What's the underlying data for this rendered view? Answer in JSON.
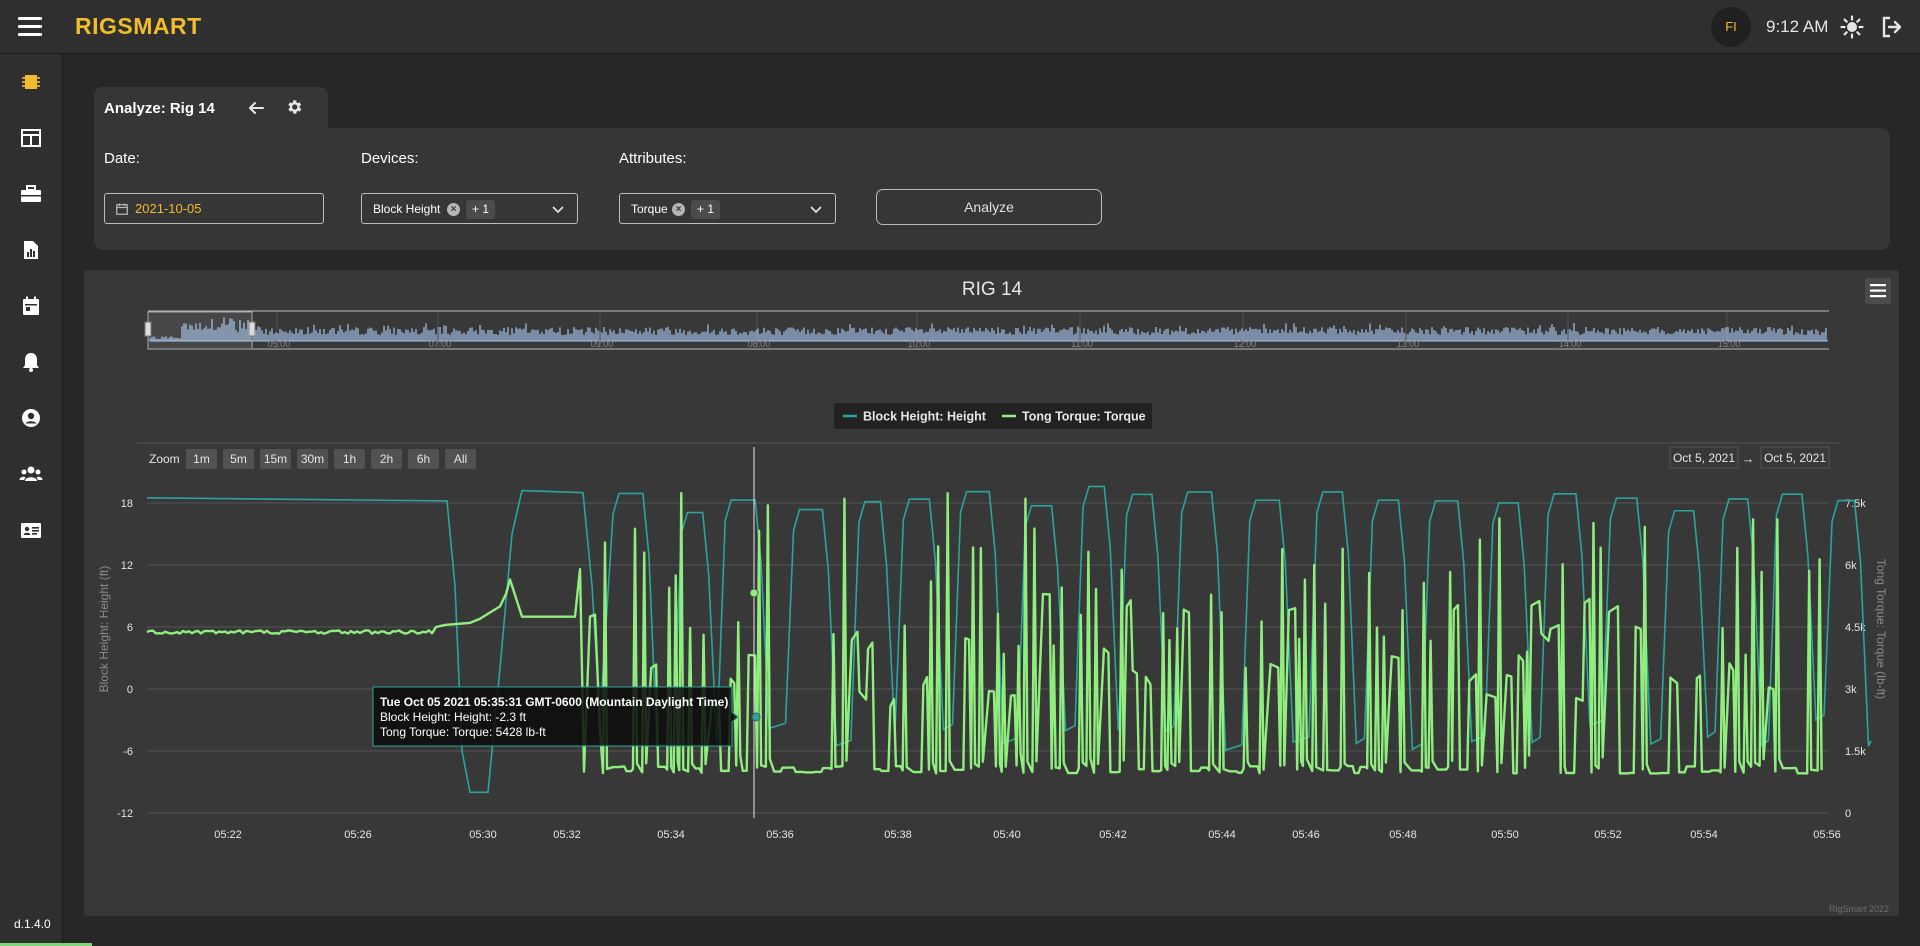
{
  "app": {
    "brand": "RIGSMART",
    "user_initials": "FI",
    "time": "9:12 AM",
    "version": "d.1.4.0",
    "credit": "RigSmart 2022",
    "accent_color": "#f2bd2c"
  },
  "sidebar": {
    "items": [
      {
        "name": "chip-icon"
      },
      {
        "name": "layout-icon"
      },
      {
        "name": "toolbox-icon"
      },
      {
        "name": "report-icon"
      },
      {
        "name": "calendar-icon"
      },
      {
        "name": "bell-icon"
      },
      {
        "name": "user-circle-icon"
      },
      {
        "name": "users-icon"
      },
      {
        "name": "id-card-icon"
      }
    ]
  },
  "analyze_tab": {
    "title": "Analyze: Rig 14"
  },
  "filters": {
    "date_label": "Date:",
    "date_value": "2021-10-05",
    "devices_label": "Devices:",
    "devices_selected": "Block Height",
    "devices_more": "+ 1",
    "attributes_label": "Attributes:",
    "attributes_selected": "Torque",
    "attributes_more": "+ 1",
    "analyze_button": "Analyze"
  },
  "chart_data": {
    "type": "line",
    "title": "RIG 14",
    "zoom_label": "Zoom",
    "zoom_buttons": [
      "1m",
      "5m",
      "15m",
      "30m",
      "1h",
      "2h",
      "6h",
      "All"
    ],
    "range_from": "Oct 5, 2021",
    "range_to": "Oct 5, 2021",
    "range_arrow": "→",
    "navigator_ticks": [
      "05:00",
      "07:00",
      "09:00",
      "08:00",
      "10:00",
      "11:00",
      "12:00",
      "13:00",
      "14:00",
      "15:00"
    ],
    "x_ticks": [
      "05:22",
      "05:26",
      "05:30",
      "05:32",
      "05:34",
      "05:36",
      "05:38",
      "05:40",
      "05:42",
      "05:44",
      "05:46",
      "05:48",
      "05:50",
      "05:52",
      "05:54",
      "05:56"
    ],
    "y_left": {
      "label": "Block Height: Height (ft)",
      "ticks": [
        "18",
        "12",
        "6",
        "0",
        "-6",
        "-12"
      ],
      "range": [
        -12,
        18
      ]
    },
    "y_right": {
      "label": "Tong Torque: Torque (lb-ft)",
      "ticks": [
        "7.5k",
        "6k",
        "4.5k",
        "3k",
        "1.5k",
        "0"
      ],
      "range": [
        0,
        7500
      ]
    },
    "series": [
      {
        "name": "Block Height: Height",
        "color": "#2aa59b",
        "axis": "left"
      },
      {
        "name": "Tong Torque: Torque",
        "color": "#90ee7e",
        "axis": "right"
      }
    ],
    "tooltip": {
      "header": "Tue Oct 05 2021 05:35:31 GMT-0600 (Mountain Daylight Time)",
      "line1": "Block Height: Height: -2.3 ft",
      "line2": "Tong Torque: Torque: 5428 lb-ft"
    }
  }
}
